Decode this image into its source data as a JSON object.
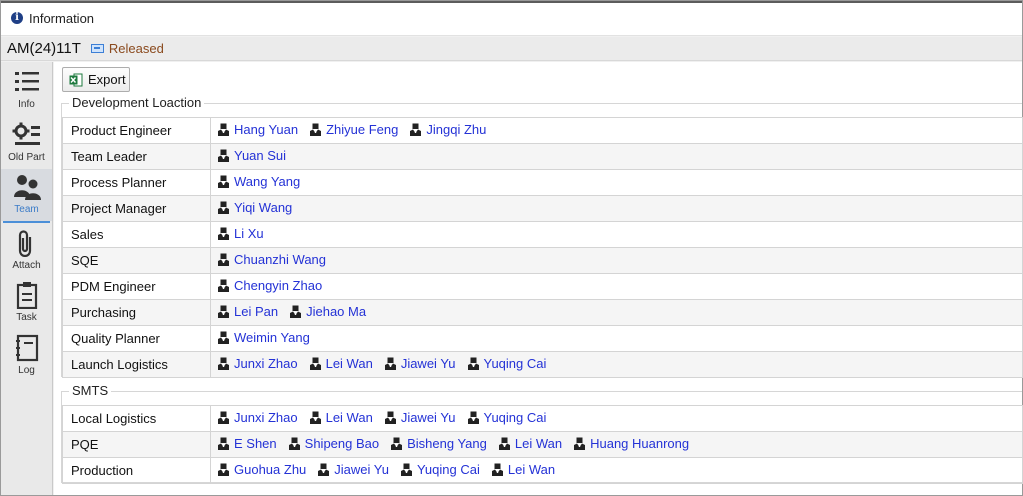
{
  "window": {
    "title": "Information"
  },
  "header": {
    "doc_id": "AM(24)11T",
    "status": "Released"
  },
  "sidebar": {
    "items": [
      {
        "label": "Info",
        "icon": "list-icon"
      },
      {
        "label": "Old Part",
        "icon": "gear-list-icon"
      },
      {
        "label": "Team",
        "icon": "team-icon",
        "active": true
      },
      {
        "label": "Attach",
        "icon": "paperclip-icon"
      },
      {
        "label": "Task",
        "icon": "clipboard-icon"
      },
      {
        "label": "Log",
        "icon": "notebook-icon"
      }
    ]
  },
  "toolbar": {
    "export_label": "Export"
  },
  "groups": [
    {
      "title": "Development Loaction",
      "rows": [
        {
          "role": "Product Engineer",
          "people": [
            "Hang Yuan",
            "Zhiyue Feng",
            "Jingqi Zhu"
          ]
        },
        {
          "role": "Team Leader",
          "people": [
            "Yuan Sui"
          ]
        },
        {
          "role": "Process Planner",
          "people": [
            "Wang Yang"
          ]
        },
        {
          "role": "Project Manager",
          "people": [
            "Yiqi Wang"
          ]
        },
        {
          "role": "Sales",
          "people": [
            "Li Xu"
          ]
        },
        {
          "role": "SQE",
          "people": [
            "Chuanzhi Wang"
          ]
        },
        {
          "role": "PDM Engineer",
          "people": [
            "Chengyin Zhao"
          ]
        },
        {
          "role": "Purchasing",
          "people": [
            "Lei Pan",
            "Jiehao Ma"
          ]
        },
        {
          "role": "Quality Planner",
          "people": [
            "Weimin Yang"
          ]
        },
        {
          "role": "Launch Logistics",
          "people": [
            "Junxi Zhao",
            "Lei Wan",
            "Jiawei Yu",
            "Yuqing Cai"
          ]
        }
      ]
    },
    {
      "title": "SMTS",
      "rows": [
        {
          "role": "Local Logistics",
          "people": [
            "Junxi Zhao",
            "Lei Wan",
            "Jiawei Yu",
            "Yuqing Cai"
          ]
        },
        {
          "role": "PQE",
          "people": [
            "E Shen",
            "Shipeng Bao",
            "Bisheng Yang",
            "Lei Wan",
            "Huang Huanrong"
          ]
        },
        {
          "role": "Production",
          "people": [
            "Guohua Zhu",
            "Jiawei Yu",
            "Yuqing Cai",
            "Lei Wan"
          ]
        }
      ]
    }
  ],
  "colors": {
    "link": "#2432d6",
    "status": "#8a4a1e",
    "accent": "#4b8fd8"
  }
}
